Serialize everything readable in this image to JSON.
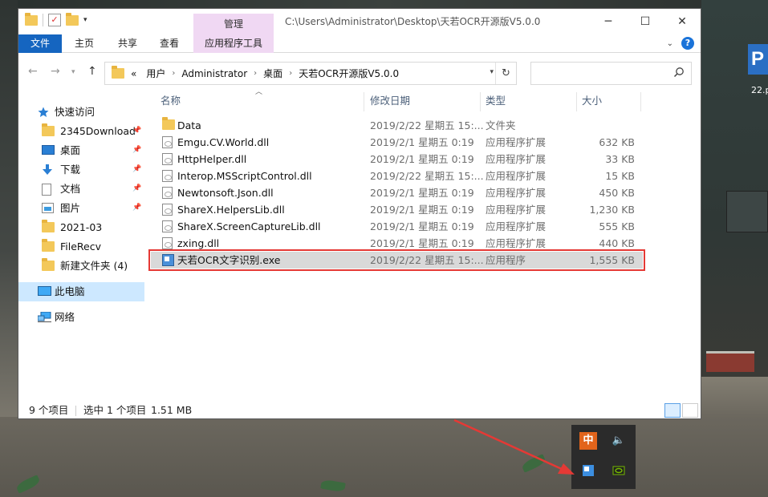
{
  "window": {
    "title_path": "C:\\Users\\Administrator\\Desktop\\天若OCR开源版V5.0.0",
    "manage_tab": "管理",
    "minimize": "─",
    "maximize": "☐",
    "close": "✕"
  },
  "ribbon": {
    "tabs": [
      "文件",
      "主页",
      "共享",
      "查看",
      "应用程序工具"
    ],
    "help": "?"
  },
  "address": {
    "overflow": "«",
    "crumbs": [
      "用户",
      "Administrator",
      "桌面",
      "天若OCR开源版V5.0.0"
    ],
    "search_placeholder": ""
  },
  "navpane": {
    "quick_access": "快速访问",
    "items": [
      {
        "label": "2345Download",
        "icon": "folder-icon",
        "pinned": true
      },
      {
        "label": "桌面",
        "icon": "desktop-icon",
        "pinned": true
      },
      {
        "label": "下载",
        "icon": "download-icon",
        "pinned": true
      },
      {
        "label": "文档",
        "icon": "document-icon",
        "pinned": true
      },
      {
        "label": "图片",
        "icon": "picture-icon",
        "pinned": true
      },
      {
        "label": "2021-03",
        "icon": "folder-icon",
        "pinned": false
      },
      {
        "label": "FileRecv",
        "icon": "folder-icon",
        "pinned": false
      },
      {
        "label": "新建文件夹 (4)",
        "icon": "folder-icon",
        "pinned": false
      }
    ],
    "this_pc": "此电脑",
    "network": "网络"
  },
  "columns": {
    "name": "名称",
    "date": "修改日期",
    "type": "类型",
    "size": "大小"
  },
  "files": [
    {
      "name": "Data",
      "date": "2019/2/22 星期五 15:...",
      "type": "文件夹",
      "size": "",
      "icon": "folder-icon"
    },
    {
      "name": "Emgu.CV.World.dll",
      "date": "2019/2/1 星期五 0:19",
      "type": "应用程序扩展",
      "size": "632 KB",
      "icon": "dll-icon"
    },
    {
      "name": "HttpHelper.dll",
      "date": "2019/2/1 星期五 0:19",
      "type": "应用程序扩展",
      "size": "33 KB",
      "icon": "dll-icon"
    },
    {
      "name": "Interop.MSScriptControl.dll",
      "date": "2019/2/22 星期五 15:...",
      "type": "应用程序扩展",
      "size": "15 KB",
      "icon": "dll-icon"
    },
    {
      "name": "Newtonsoft.Json.dll",
      "date": "2019/2/1 星期五 0:19",
      "type": "应用程序扩展",
      "size": "450 KB",
      "icon": "dll-icon"
    },
    {
      "name": "ShareX.HelpersLib.dll",
      "date": "2019/2/1 星期五 0:19",
      "type": "应用程序扩展",
      "size": "1,230 KB",
      "icon": "dll-icon"
    },
    {
      "name": "ShareX.ScreenCaptureLib.dll",
      "date": "2019/2/1 星期五 0:19",
      "type": "应用程序扩展",
      "size": "555 KB",
      "icon": "dll-icon"
    },
    {
      "name": "zxing.dll",
      "date": "2019/2/1 星期五 0:19",
      "type": "应用程序扩展",
      "size": "440 KB",
      "icon": "dll-icon"
    },
    {
      "name": "天若OCR文字识别.exe",
      "date": "2019/2/22 星期五 15:...",
      "type": "应用程序",
      "size": "1,555 KB",
      "icon": "exe-icon",
      "selected": true
    }
  ],
  "status": {
    "count": "9 个项目",
    "selection": "选中 1 个项目",
    "size": "1.51 MB"
  },
  "tray": {
    "ime": "中"
  },
  "wallpaper_caption": "22.p",
  "ppt_letter": "P",
  "colors": {
    "accent": "#1565c0",
    "annotation": "#e53935",
    "app_tools": "#f0d8f3"
  }
}
